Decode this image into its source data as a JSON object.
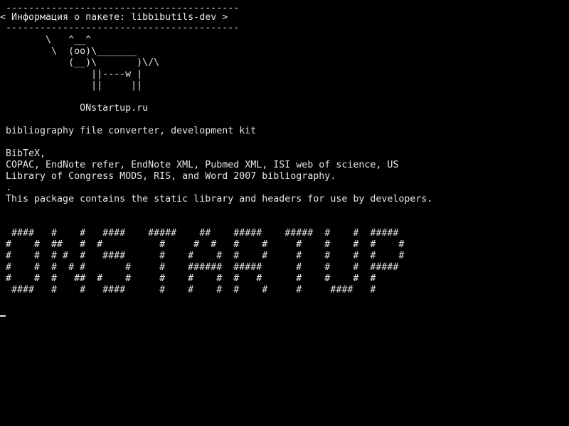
{
  "terminal": {
    "bubble": {
      "border_top": " -----------------------------------------",
      "title": "< Информация о пакете: libbibutils-dev >",
      "border_bottom": " -----------------------------------------"
    },
    "cow": [
      "        \\   ^__^",
      "         \\  (oo)\\_______",
      "            (__)\\       )\\/\\",
      "                ||----w |",
      "                ||     ||"
    ],
    "site": "              ONstartup.ru",
    "summary": " bibliography file converter, development kit",
    "description": [
      " BibTeX,",
      " COPAC, EndNote refer, EndNote XML, Pubmed XML, ISI web of science, US",
      " Library of Congress MODS, RIS, and Word 2007 bibliography.",
      " .",
      " This package contains the static library and headers for use by developers."
    ],
    "banner": [
      "  ####   #    #   ####    #####    ##    #####    #####  #    #  #####",
      " #    #  ##   #  #          #     #  #   #    #     #    #    #  #    #",
      " #    #  # #  #   ####      #    #    #  #    #     #    #    #  #    #",
      " #    #  #  # #       #     #    ######  #####      #    #    #  #####",
      " #    #  #   ##  #    #     #    #    #  #   #      #    #    #  #",
      "  ####   #    #   ####      #    #    #  #    #     #     ####   #"
    ],
    "colors": {
      "background": "#000000",
      "foreground": "#e6e6e6"
    }
  }
}
